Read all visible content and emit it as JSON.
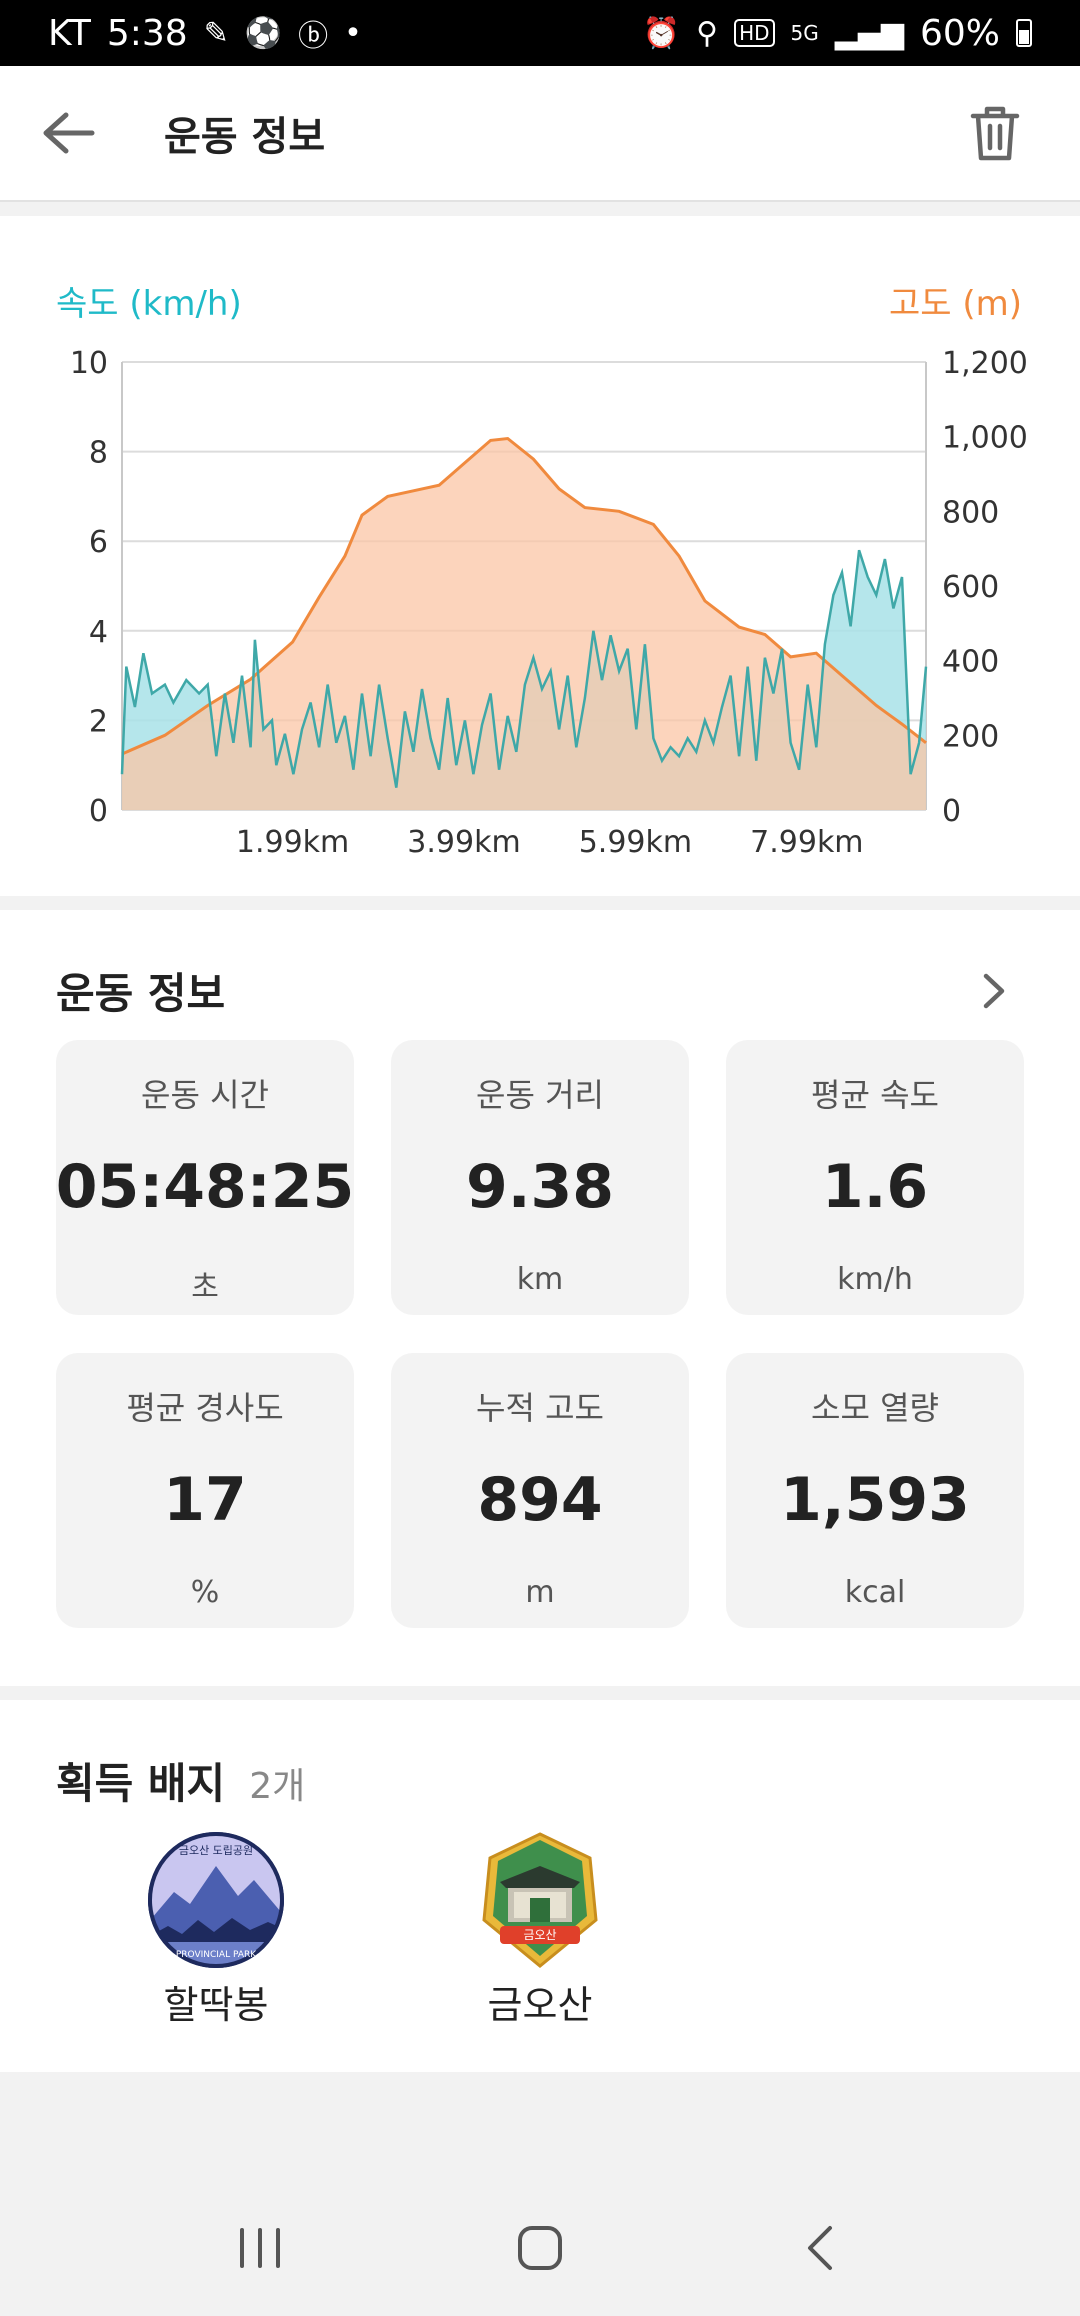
{
  "status_bar": {
    "carrier": "KT",
    "time": "5:38",
    "battery": "60%",
    "network": "5G",
    "hd": "HD"
  },
  "app_bar": {
    "title": "운동 정보"
  },
  "chart_data": {
    "type": "area",
    "left_axis_label": "속도 (km/h)",
    "right_axis_label": "고도 (m)",
    "x_ticks": [
      "1.99km",
      "3.99km",
      "5.99km",
      "7.99km"
    ],
    "x_tick_values": [
      1.99,
      3.99,
      5.99,
      7.99
    ],
    "x_range": [
      0,
      9.38
    ],
    "y_left_ticks": [
      "0",
      "2",
      "4",
      "6",
      "8",
      "10"
    ],
    "y_left_range": [
      0,
      10
    ],
    "y_right_ticks": [
      "0",
      "200",
      "400",
      "600",
      "800",
      "1,000",
      "1,200"
    ],
    "y_right_range": [
      0,
      1200
    ],
    "grid": true,
    "series": [
      {
        "name": "고도 (m)",
        "axis": "right",
        "color": "#f7a37a",
        "points": [
          [
            0,
            150
          ],
          [
            0.5,
            200
          ],
          [
            1.0,
            280
          ],
          [
            1.5,
            350
          ],
          [
            1.99,
            450
          ],
          [
            2.3,
            570
          ],
          [
            2.6,
            680
          ],
          [
            2.8,
            790
          ],
          [
            3.1,
            840
          ],
          [
            3.4,
            855
          ],
          [
            3.7,
            870
          ],
          [
            4.0,
            930
          ],
          [
            4.3,
            990
          ],
          [
            4.5,
            995
          ],
          [
            4.8,
            940
          ],
          [
            5.1,
            860
          ],
          [
            5.4,
            810
          ],
          [
            5.8,
            800
          ],
          [
            6.2,
            765
          ],
          [
            6.5,
            680
          ],
          [
            6.8,
            560
          ],
          [
            7.2,
            490
          ],
          [
            7.5,
            470
          ],
          [
            7.8,
            410
          ],
          [
            8.1,
            420
          ],
          [
            8.4,
            360
          ],
          [
            8.8,
            280
          ],
          [
            9.1,
            230
          ],
          [
            9.38,
            180
          ]
        ]
      },
      {
        "name": "속도 (km/h)",
        "axis": "left",
        "color": "#5cc8d0",
        "points": [
          [
            0.0,
            0.8
          ],
          [
            0.05,
            3.2
          ],
          [
            0.15,
            2.3
          ],
          [
            0.25,
            3.5
          ],
          [
            0.35,
            2.6
          ],
          [
            0.5,
            2.8
          ],
          [
            0.6,
            2.4
          ],
          [
            0.75,
            2.9
          ],
          [
            0.9,
            2.6
          ],
          [
            1.0,
            2.8
          ],
          [
            1.1,
            1.2
          ],
          [
            1.2,
            2.6
          ],
          [
            1.3,
            1.5
          ],
          [
            1.4,
            3.0
          ],
          [
            1.5,
            1.4
          ],
          [
            1.55,
            3.8
          ],
          [
            1.65,
            1.8
          ],
          [
            1.75,
            2.0
          ],
          [
            1.8,
            1.0
          ],
          [
            1.9,
            1.7
          ],
          [
            2.0,
            0.8
          ],
          [
            2.1,
            1.8
          ],
          [
            2.2,
            2.4
          ],
          [
            2.3,
            1.4
          ],
          [
            2.4,
            2.8
          ],
          [
            2.5,
            1.5
          ],
          [
            2.6,
            2.1
          ],
          [
            2.7,
            0.9
          ],
          [
            2.8,
            2.6
          ],
          [
            2.9,
            1.2
          ],
          [
            3.0,
            2.8
          ],
          [
            3.1,
            1.6
          ],
          [
            3.2,
            0.5
          ],
          [
            3.3,
            2.2
          ],
          [
            3.4,
            1.3
          ],
          [
            3.5,
            2.7
          ],
          [
            3.6,
            1.6
          ],
          [
            3.7,
            0.9
          ],
          [
            3.8,
            2.5
          ],
          [
            3.9,
            1.0
          ],
          [
            4.0,
            2.0
          ],
          [
            4.1,
            0.8
          ],
          [
            4.2,
            1.9
          ],
          [
            4.3,
            2.6
          ],
          [
            4.4,
            0.9
          ],
          [
            4.5,
            2.1
          ],
          [
            4.6,
            1.3
          ],
          [
            4.7,
            2.8
          ],
          [
            4.8,
            3.4
          ],
          [
            4.9,
            2.7
          ],
          [
            5.0,
            3.1
          ],
          [
            5.1,
            1.8
          ],
          [
            5.2,
            3.0
          ],
          [
            5.3,
            1.4
          ],
          [
            5.4,
            2.5
          ],
          [
            5.5,
            4.0
          ],
          [
            5.6,
            2.9
          ],
          [
            5.7,
            3.9
          ],
          [
            5.8,
            3.1
          ],
          [
            5.9,
            3.6
          ],
          [
            6.0,
            1.8
          ],
          [
            6.1,
            3.7
          ],
          [
            6.2,
            1.6
          ],
          [
            6.3,
            1.1
          ],
          [
            6.4,
            1.4
          ],
          [
            6.5,
            1.2
          ],
          [
            6.6,
            1.6
          ],
          [
            6.7,
            1.3
          ],
          [
            6.8,
            2.0
          ],
          [
            6.9,
            1.5
          ],
          [
            7.0,
            2.3
          ],
          [
            7.1,
            3.0
          ],
          [
            7.2,
            1.2
          ],
          [
            7.3,
            3.2
          ],
          [
            7.4,
            1.1
          ],
          [
            7.5,
            3.4
          ],
          [
            7.6,
            2.6
          ],
          [
            7.7,
            3.6
          ],
          [
            7.8,
            1.5
          ],
          [
            7.9,
            0.9
          ],
          [
            8.0,
            2.8
          ],
          [
            8.1,
            1.4
          ],
          [
            8.2,
            3.7
          ],
          [
            8.3,
            4.8
          ],
          [
            8.4,
            5.3
          ],
          [
            8.5,
            4.1
          ],
          [
            8.6,
            5.8
          ],
          [
            8.7,
            5.2
          ],
          [
            8.8,
            4.8
          ],
          [
            8.9,
            5.6
          ],
          [
            9.0,
            4.5
          ],
          [
            9.1,
            5.2
          ],
          [
            9.2,
            0.8
          ],
          [
            9.3,
            1.5
          ],
          [
            9.38,
            3.2
          ]
        ]
      }
    ]
  },
  "stats": {
    "title": "운동 정보",
    "tiles": [
      {
        "label": "운동 시간",
        "value": "05:48:25",
        "unit": "초"
      },
      {
        "label": "운동 거리",
        "value": "9.38",
        "unit": "km"
      },
      {
        "label": "평균 속도",
        "value": "1.6",
        "unit": "km/h"
      },
      {
        "label": "평균 경사도",
        "value": "17",
        "unit": "%"
      },
      {
        "label": "누적 고도",
        "value": "894",
        "unit": "m"
      },
      {
        "label": "소모 열량",
        "value": "1,593",
        "unit": "kcal"
      }
    ]
  },
  "badges": {
    "title": "획득 배지",
    "count": "2개",
    "items": [
      {
        "name": "할딱봉",
        "icon": "mountain-park-badge-icon",
        "emblem_text": "금오산 도립공원",
        "footer_text": "PROVINCIAL PARK"
      },
      {
        "name": "금오산",
        "icon": "temple-gate-badge-icon",
        "emblem_text": "금오산"
      }
    ]
  },
  "colors": {
    "speed": "#1fbac8",
    "altitude": "#f08a3e",
    "speed_fill": "#a8e2e8",
    "altitude_fill": "#fbc5a6"
  }
}
